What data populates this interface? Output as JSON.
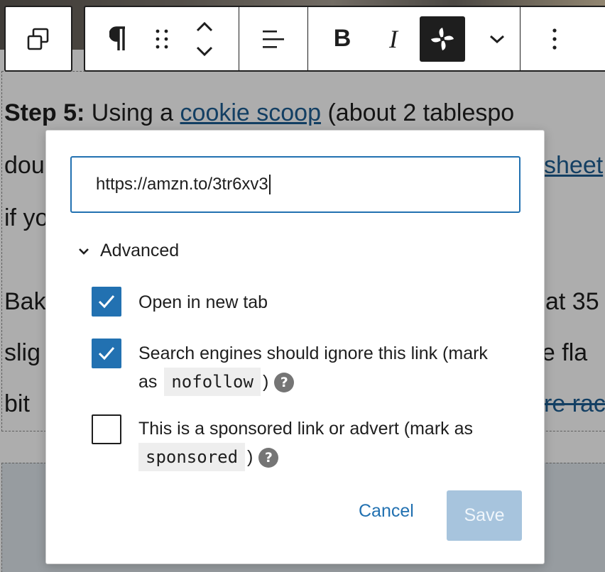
{
  "content": {
    "para1_line1": {
      "prefix": "Step 5:",
      "before_link": " Using a ",
      "link": "cookie scoop",
      "after_link": " (about 2 tablespo"
    },
    "para1_line2": {
      "before": "dou",
      "link": "sheet"
    },
    "para1_line3": {
      "text": "if yo"
    },
    "para2_line1": {
      "before": "Bak",
      "after": "at 35"
    },
    "para2_line2": {
      "before": "slig",
      "after": "ne fla"
    },
    "para2_line3": {
      "before": "bit",
      "strike": "re rac"
    }
  },
  "toolbar": {
    "block_type_icon": "duplicate-blocks-icon",
    "paragraph_icon": "pilcrow-icon",
    "drag_icon": "drag-handle-icon",
    "move_icon": "move-up-down-icon",
    "align_icon": "align-left-icon",
    "bold_label": "B",
    "italic_label": "I",
    "link_icon": "link-pinwheel-icon",
    "more_formats_icon": "chevron-down-icon",
    "options_icon": "more-vertical-icon"
  },
  "link_popover": {
    "url_value": "https://amzn.to/3tr6xv3",
    "advanced_label": "Advanced",
    "options": [
      {
        "label": "Open in new tab",
        "checked": true
      },
      {
        "label_before": "Search engines should ignore this link (mark",
        "label_line2_before": "as",
        "code": "nofollow",
        "label_after": ")",
        "checked": true
      },
      {
        "label_before": "This is a sponsored link or advert (mark as",
        "code": "sponsored",
        "label_after": ")",
        "checked": false
      }
    ],
    "help_glyph": "?",
    "cancel_label": "Cancel",
    "save_label": "Save"
  },
  "colors": {
    "accent": "#2271b1",
    "link_text": "#1d5e93",
    "save_disabled_bg": "#a7c4dd",
    "help_icon": "#757575"
  }
}
